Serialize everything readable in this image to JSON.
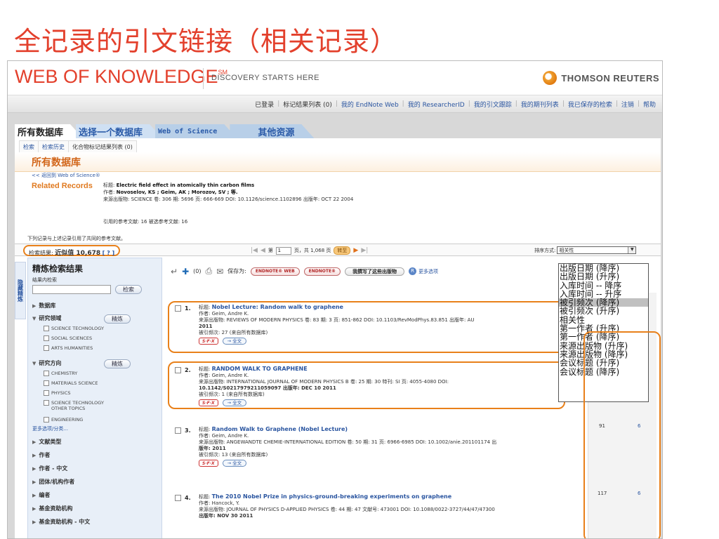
{
  "slide_title": "全记录的引文链接（相关记录）",
  "header": {
    "logo": "WEB OF KNOWLEDGE",
    "logo_mark": "SM",
    "tagline": "DISCOVERY STARTS HERE",
    "publisher": "THOMSON REUTERS"
  },
  "util_links": {
    "logged_in": "已登录",
    "marked_list": "标记结果列表 (0)",
    "endnote": "我的 EndNote Web",
    "researcherid": "我的 ResearcherID",
    "citation_alerts": "我的引文跟踪",
    "journal_list": "我的期刊列表",
    "saved_searches": "我已保存的检索",
    "logout": "注销",
    "help": "帮助"
  },
  "tabs": [
    "所有数据库",
    "选择一个数据库",
    "Web of Science",
    "其他资源"
  ],
  "subnav": [
    "检索",
    "检索历史",
    "化合物标记结果列表 (0)"
  ],
  "db_title": "所有数据库",
  "back_link": "<< 返回到 Web of Science®",
  "related": {
    "label": "Related Records",
    "title_prefix": "标题:",
    "title": "Electric field effect in atomically thin carbon films",
    "authors_prefix": "作者:",
    "authors": "Novoselov, KS ; Geim, AK ; Morozov, SV ; 等.",
    "source_line": "来源出版物: SCIENCE  卷: 306  期: 5696  页: 666-669  DOI: 10.1126/science.1102896  出版年: OCT 22 2004",
    "cite_line": "引用的参考文献: 16 被选参考文献: 16"
  },
  "note": "下列记录与上述记录引用了共同的参考文献。",
  "results": {
    "count_label": "检索结果:",
    "count_value": "近似值 10,678",
    "count_help": "[ ? ]",
    "page_prefix": "第",
    "page_value": "1",
    "page_suffix": "页，共 1,068 页",
    "go": "转至",
    "sort_label": "排序方式:",
    "sort_value": "相关性"
  },
  "refine": {
    "side_tab": "隐藏精炼",
    "title": "精炼检索结果",
    "within_label": "结果内检索",
    "search_btn": "检索",
    "facets": [
      {
        "label": "数据库",
        "open": false
      },
      {
        "label": "研究领域",
        "open": true,
        "btn": "精炼",
        "items": [
          "SCIENCE TECHNOLOGY",
          "SOCIAL SCIENCES",
          "ARTS HUMANITIES"
        ]
      },
      {
        "label": "研究方向",
        "open": true,
        "btn": "精炼",
        "items": [
          "CHEMISTRY",
          "MATERIALS SCIENCE",
          "PHYSICS",
          "SCIENCE TECHNOLOGY OTHER TOPICS",
          "ENGINEERING"
        ]
      }
    ],
    "more": "更多选项/分类...",
    "collapsed": [
      "文献类型",
      "作者",
      "作者 - 中文",
      "团体/机构作者",
      "编者",
      "基金资助机构",
      "基金资助机构 - 中文"
    ]
  },
  "toolbar": {
    "marked": "(0)",
    "save_as": "保存为:",
    "endnote_web": "ENDNOTE® WEB",
    "endnote": "ENDNOTE®",
    "wrote": "我撰写了这些出版物",
    "more": "更多选项"
  },
  "records": [
    {
      "num": "1.",
      "title": "Nobel Lecture: Random walk to graphene",
      "authors": "作者: Geim, Andre K.",
      "source": "来源出版物: REVIEWS OF MODERN PHYSICS  卷: 83  期: 3  页: 851-862  DOI: 10.1103/RevModPhys.83.851  出版年: AU",
      "year": "2011",
      "cited": "被引频次:  27  (来自所有数据库)"
    },
    {
      "num": "2.",
      "title": "RANDOM WALK TO GRAPHENE",
      "authors": "作者: Geim, Andre K.",
      "source": "来源出版物: INTERNATIONAL JOURNAL OF MODERN PHYSICS B  卷: 25  期: 30  特刊: SI  页: 4055-4080  DOI:",
      "year": "10.1142/S0217979211059097  出版年: DEC 10 2011",
      "cited": "被引频次:  1  (来自所有数据库)"
    },
    {
      "num": "3.",
      "title": "Random Walk to Graphene (Nobel Lecture)",
      "authors": "作者: Geim, Andre K.",
      "source": "来源出版物: ANGEWANDTE CHEMIE-INTERNATIONAL EDITION  卷: 50  期: 31  页: 6966-6985  DOI: 10.1002/anie.201101174  出",
      "year": "版年: 2011",
      "cited": "被引频次:  13  (来自所有数据库)",
      "m1": "91",
      "m2": "6"
    },
    {
      "num": "4.",
      "title": "The 2010 Nobel Prize in physics-ground-breaking experiments on graphene",
      "authors": "作者: Hancock, Y.",
      "source": "来源出版物: JOURNAL OF PHYSICS D-APPLIED PHYSICS  卷: 44  期: 47  文献号: 473001  DOI: 10.1088/0022-3727/44/47/47300",
      "year": "出版年: NOV 30 2011",
      "cited": "",
      "m1": "117",
      "m2": "6"
    }
  ],
  "sfx_label": "S·F·X",
  "fulltext_label": "→ 全文",
  "sort_options": [
    "出版日期 (降序)",
    "出版日期 (升序)",
    "入库时间 -- 降序",
    "入库时间 -- 升序",
    "被引频次 (降序)",
    "被引频次 (升序)",
    "相关性",
    "第一作者 (升序)",
    "第一作者 (降序)",
    "来源出版物 (升序)",
    "来源出版物 (降序)",
    "会议标题 (升序)",
    "会议标题 (降序)"
  ],
  "sort_selected_index": 4,
  "colors": {
    "accent": "#e3402c",
    "highlight": "#e8801a",
    "link": "#2a55a0"
  }
}
